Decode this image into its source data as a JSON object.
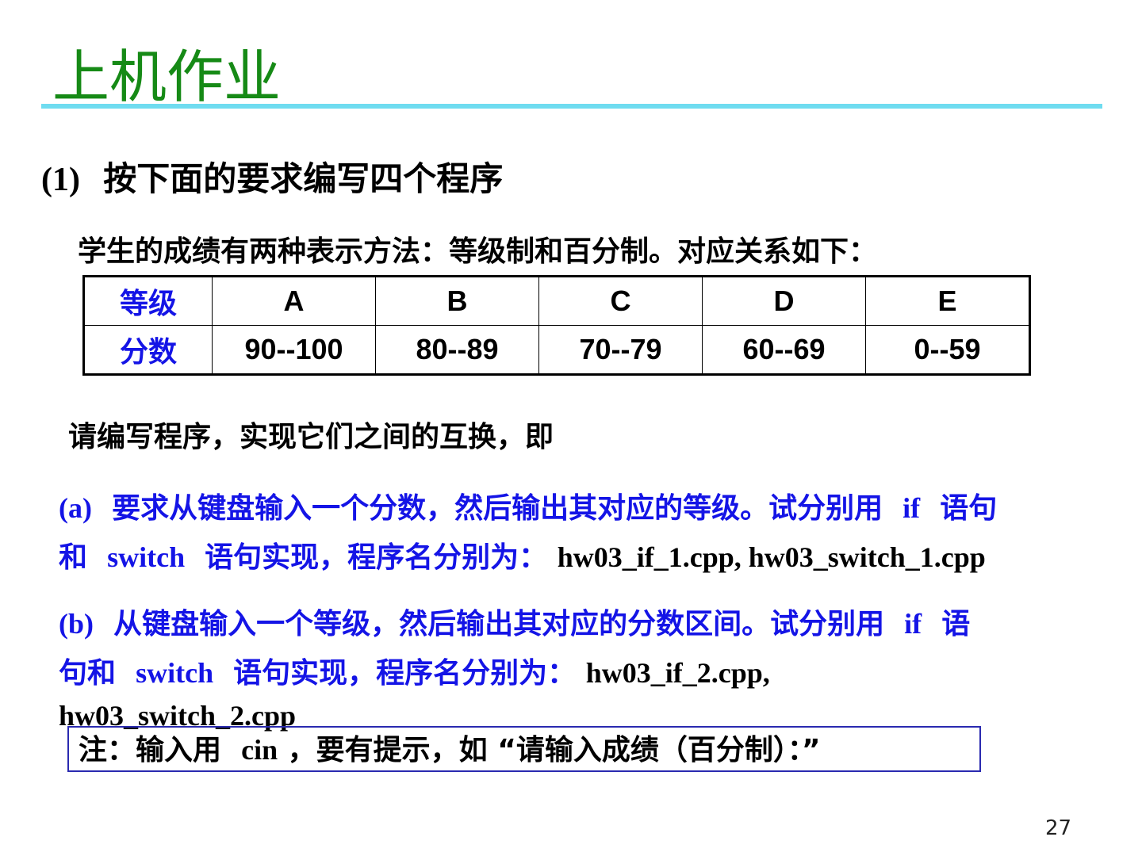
{
  "title": "上机作业",
  "section": {
    "number": "(1)",
    "text": "按下面的要求编写四个程序"
  },
  "intro": "学生的成绩有两种表示方法：等级制和百分制。对应关系如下：",
  "table": {
    "row_headers": [
      "等级",
      "分数"
    ],
    "grades": [
      "A",
      "B",
      "C",
      "D",
      "E"
    ],
    "scores": [
      "90--100",
      "80--89",
      "70--79",
      "60--69",
      "0--59"
    ]
  },
  "ask": "请编写程序，实现它们之间的互换，即",
  "item_a": {
    "label": "(a)",
    "text1": "要求从键盘输入一个分数，然后输出其对应的等级。试分别用",
    "kw_if": "if",
    "text2": "语句",
    "text3": "和",
    "kw_switch": "switch",
    "text4": "语句实现，程序名分别为：",
    "files": "hw03_if_1.cpp,  hw03_switch_1.cpp"
  },
  "item_b": {
    "label": "(b)",
    "text1": "从键盘输入一个等级，然后输出其对应的分数区间。试分别用",
    "kw_if": "if",
    "text2": "语",
    "text3": "句和",
    "kw_switch": "switch",
    "text4": "语句实现，程序名分别为：",
    "file1": "hw03_if_2.cpp,",
    "file2": "hw03_switch_2.cpp"
  },
  "note": {
    "prefix": "注：输入用",
    "kw": "cin",
    "suffix": "，要有提示，如 “请输入成绩（百分制）：”"
  },
  "page_number": "27",
  "colors": {
    "title": "#168a16",
    "rule": "#6fdcf0",
    "accent": "#1414e6"
  }
}
